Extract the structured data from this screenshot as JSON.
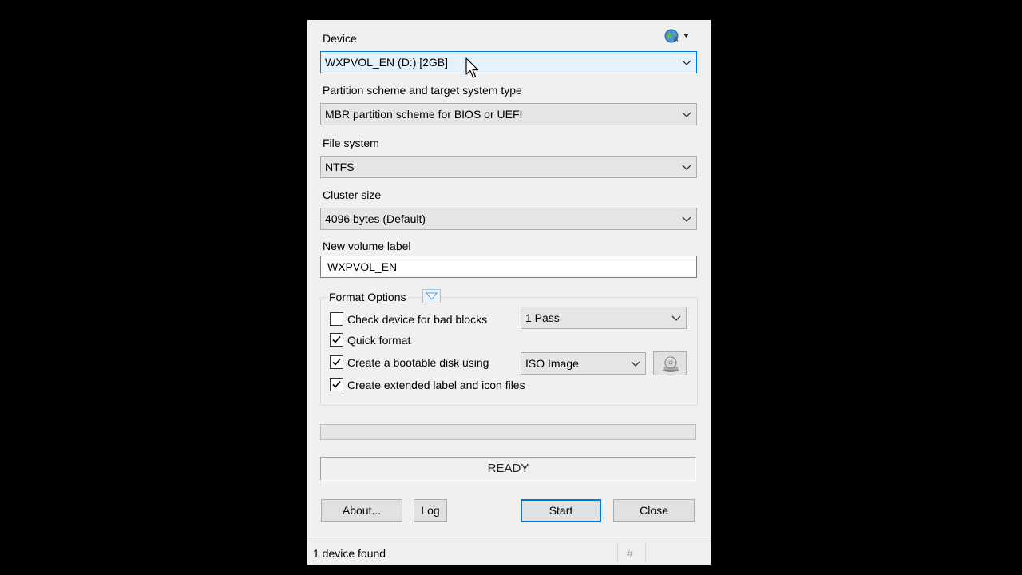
{
  "device": {
    "label": "Device",
    "selected": "WXPVOL_EN (D:) [2GB]",
    "language_icon": "globe-language-icon"
  },
  "partition": {
    "label": "Partition scheme and target system type",
    "selected": "MBR partition scheme for BIOS or UEFI"
  },
  "filesystem": {
    "label": "File system",
    "selected": "NTFS"
  },
  "cluster": {
    "label": "Cluster size",
    "selected": "4096 bytes (Default)"
  },
  "volume": {
    "label": "New volume label",
    "value": "WXPVOL_EN"
  },
  "format_options": {
    "title": "Format Options",
    "bad_blocks": {
      "label": "Check device for bad blocks",
      "checked": false,
      "passes": "1 Pass"
    },
    "quick_format": {
      "label": "Quick format",
      "checked": true
    },
    "bootable": {
      "label": "Create a bootable disk using",
      "checked": true,
      "source": "ISO Image",
      "icon": "disc-drive-icon"
    },
    "extended_label": {
      "label": "Create extended label and icon files",
      "checked": true
    }
  },
  "progress": {
    "fraction": 0
  },
  "status": {
    "text": "READY"
  },
  "buttons": {
    "about": "About...",
    "log": "Log",
    "start": "Start",
    "close": "Close"
  },
  "statusbar": {
    "text": "1 device found",
    "hash": "#"
  },
  "colors": {
    "accent": "#0078d7",
    "window_bg": "#f0f0f0",
    "combo_bg": "#e5e5e5"
  }
}
